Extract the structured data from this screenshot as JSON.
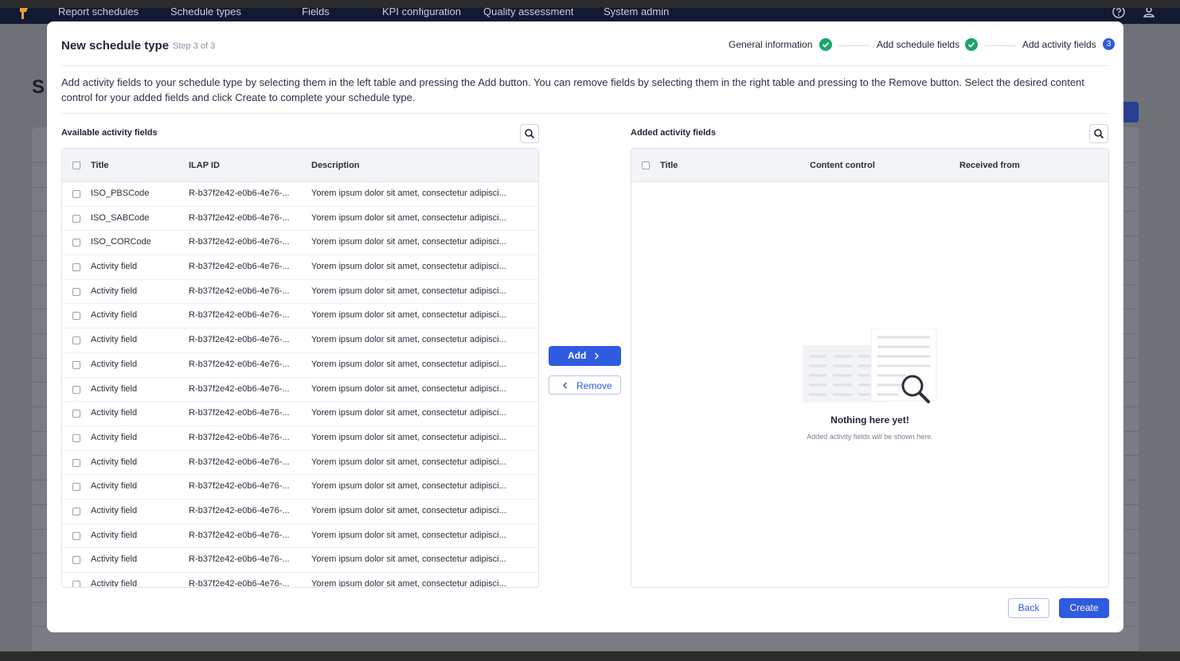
{
  "nav": {
    "items": [
      "Report schedules",
      "Schedule types",
      "Fields",
      "KPI configuration",
      "Quality assessment",
      "System admin"
    ]
  },
  "background": {
    "page_title_fragment": "S"
  },
  "modal": {
    "title": "New schedule type",
    "step_label": "Step 3 of 3",
    "steps": [
      {
        "label": "General information",
        "state": "done"
      },
      {
        "label": "Add schedule fields",
        "state": "done"
      },
      {
        "label": "Add activity fields",
        "state": "current",
        "number": "3"
      }
    ],
    "instructions": "Add activity fields to your schedule type by selecting them in the left table and pressing the Add button. You can remove fields by selecting them in the right table and pressing to the Remove button. Select the desired content control for your added fields and click Create to complete your schedule type.",
    "available": {
      "title": "Available activity fields",
      "columns": [
        "Title",
        "ILAP ID",
        "Description"
      ],
      "rows": [
        [
          "ISO_PBSCode",
          "R-b37f2e42-e0b6-4e76-...",
          "Yorem ipsum dolor sit amet, consectetur adipisci..."
        ],
        [
          "ISO_SABCode",
          "R-b37f2e42-e0b6-4e76-...",
          "Yorem ipsum dolor sit amet, consectetur adipisci..."
        ],
        [
          "ISO_CORCode",
          "R-b37f2e42-e0b6-4e76-...",
          "Yorem ipsum dolor sit amet, consectetur adipisci..."
        ],
        [
          "Activity field",
          "R-b37f2e42-e0b6-4e76-...",
          "Yorem ipsum dolor sit amet, consectetur adipisci..."
        ],
        [
          "Activity field",
          "R-b37f2e42-e0b6-4e76-...",
          "Yorem ipsum dolor sit amet, consectetur adipisci..."
        ],
        [
          "Activity field",
          "R-b37f2e42-e0b6-4e76-...",
          "Yorem ipsum dolor sit amet, consectetur adipisci..."
        ],
        [
          "Activity field",
          "R-b37f2e42-e0b6-4e76-...",
          "Yorem ipsum dolor sit amet, consectetur adipisci..."
        ],
        [
          "Activity field",
          "R-b37f2e42-e0b6-4e76-...",
          "Yorem ipsum dolor sit amet, consectetur adipisci..."
        ],
        [
          "Activity field",
          "R-b37f2e42-e0b6-4e76-...",
          "Yorem ipsum dolor sit amet, consectetur adipisci..."
        ],
        [
          "Activity field",
          "R-b37f2e42-e0b6-4e76-...",
          "Yorem ipsum dolor sit amet, consectetur adipisci..."
        ],
        [
          "Activity field",
          "R-b37f2e42-e0b6-4e76-...",
          "Yorem ipsum dolor sit amet, consectetur adipisci..."
        ],
        [
          "Activity field",
          "R-b37f2e42-e0b6-4e76-...",
          "Yorem ipsum dolor sit amet, consectetur adipisci..."
        ],
        [
          "Activity field",
          "R-b37f2e42-e0b6-4e76-...",
          "Yorem ipsum dolor sit amet, consectetur adipisci..."
        ],
        [
          "Activity field",
          "R-b37f2e42-e0b6-4e76-...",
          "Yorem ipsum dolor sit amet, consectetur adipisci..."
        ],
        [
          "Activity field",
          "R-b37f2e42-e0b6-4e76-...",
          "Yorem ipsum dolor sit amet, consectetur adipisci..."
        ],
        [
          "Activity field",
          "R-b37f2e42-e0b6-4e76-...",
          "Yorem ipsum dolor sit amet, consectetur adipisci..."
        ],
        [
          "Activity field",
          "R-b37f2e42-e0b6-4e76-...",
          "Yorem ipsum dolor sit amet, consectetur adipisci..."
        ]
      ]
    },
    "added": {
      "title": "Added activity fields",
      "columns": [
        "Title",
        "Content control",
        "Received from"
      ],
      "empty_title": "Nothing here yet!",
      "empty_subtitle": "Added activity fields will be shown here."
    },
    "add_label": "Add",
    "remove_label": "Remove",
    "back_label": "Back",
    "create_label": "Create"
  },
  "colors": {
    "accent": "#2f5be0",
    "success": "#1aa56b",
    "nav_bg": "#121a33"
  },
  "icons": [
    "app-logo-icon",
    "help-icon",
    "user-icon",
    "check-icon",
    "search-icon",
    "chevron-right-icon",
    "chevron-left-icon",
    "document-search-icon"
  ]
}
